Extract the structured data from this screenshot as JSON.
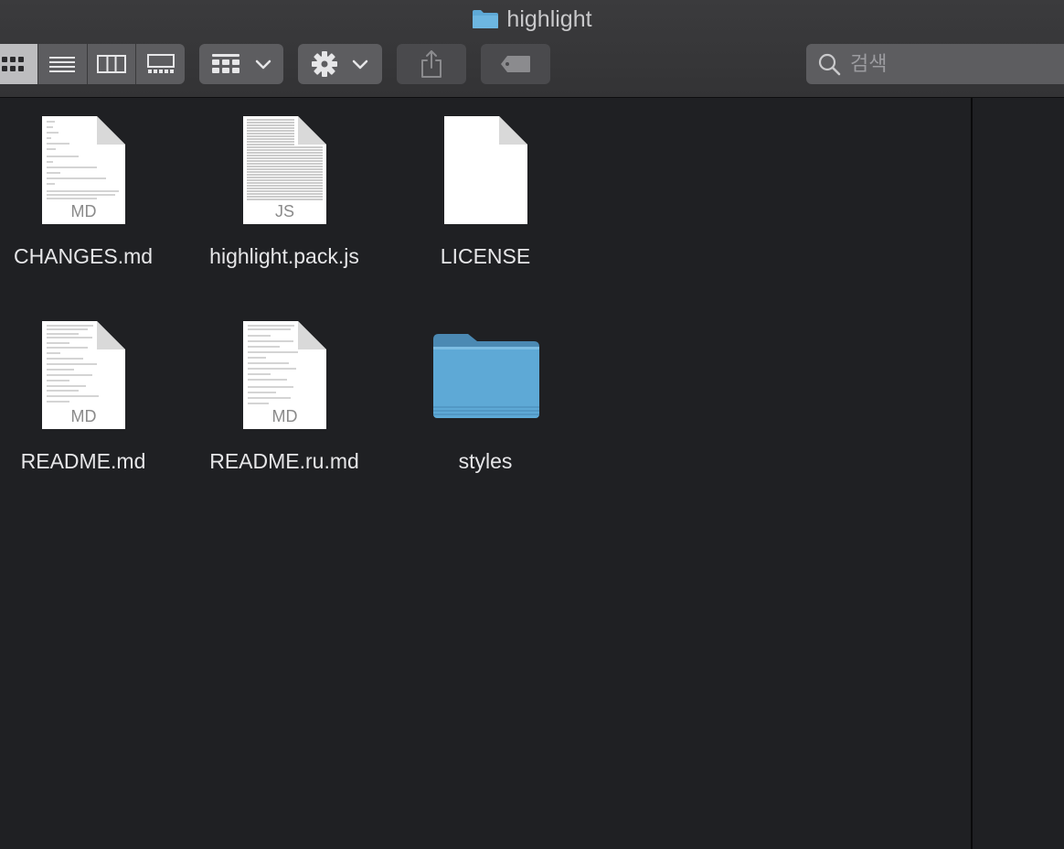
{
  "window": {
    "title": "highlight",
    "folder_icon": "folder-icon"
  },
  "toolbar": {
    "view_modes": [
      {
        "name": "icon-view-icon",
        "active": true
      },
      {
        "name": "list-view-icon",
        "active": false
      },
      {
        "name": "column-view-icon",
        "active": false
      },
      {
        "name": "gallery-view-icon",
        "active": false
      }
    ],
    "group_icon": "group-grid-icon",
    "action_icon": "gear-icon",
    "share_icon": "share-icon",
    "tag_icon": "tag-icon",
    "search_placeholder": "검색"
  },
  "files": [
    {
      "name": "CHANGES.md",
      "ext": "MD",
      "kind": "text-doc"
    },
    {
      "name": "highlight.pack.js",
      "ext": "JS",
      "kind": "dense-doc"
    },
    {
      "name": "LICENSE",
      "ext": "",
      "kind": "blank-doc"
    },
    {
      "name": "README.md",
      "ext": "MD",
      "kind": "text-doc"
    },
    {
      "name": "README.ru.md",
      "ext": "MD",
      "kind": "text-doc"
    },
    {
      "name": "styles",
      "ext": "",
      "kind": "folder"
    }
  ],
  "colors": {
    "background": "#1f2023",
    "toolbar": "#3b3b3d",
    "folder_blue": "#5ea9d6"
  }
}
